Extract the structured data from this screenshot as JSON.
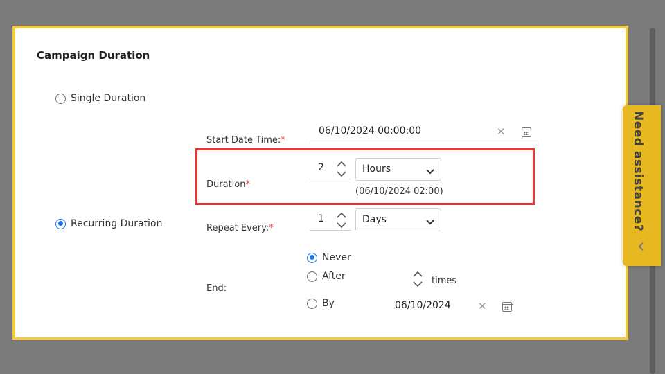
{
  "panel": {
    "title": "Campaign Duration",
    "options": {
      "single": {
        "label": "Single Duration",
        "selected": false
      },
      "recurring": {
        "label": "Recurring Duration",
        "selected": true
      }
    }
  },
  "start": {
    "label": "Start Date Time:",
    "required_mark": "*",
    "value": "06/10/2024 00:00:00",
    "clear_icon": "close-icon",
    "calendar_icon": "calendar-icon"
  },
  "duration": {
    "label": "Duration",
    "required_mark": "*",
    "value": "2",
    "unit": "Hours",
    "end_hint": "(06/10/2024 02:00)"
  },
  "repeat": {
    "label": "Repeat Every:",
    "required_mark": "*",
    "value": "1",
    "unit": "Days"
  },
  "end": {
    "label": "End:",
    "options": {
      "never": {
        "label": "Never",
        "selected": true
      },
      "after": {
        "label": "After",
        "selected": false,
        "suffix": "times"
      },
      "by": {
        "label": "By",
        "selected": false,
        "date": "06/10/2024"
      }
    }
  },
  "assist": {
    "label": "Need assistance?",
    "icon": "chevron-left-icon"
  },
  "colors": {
    "frame": "#f5c842",
    "highlight": "#e53935",
    "accent": "#1a73e8",
    "assist_bg": "#e8b820"
  }
}
